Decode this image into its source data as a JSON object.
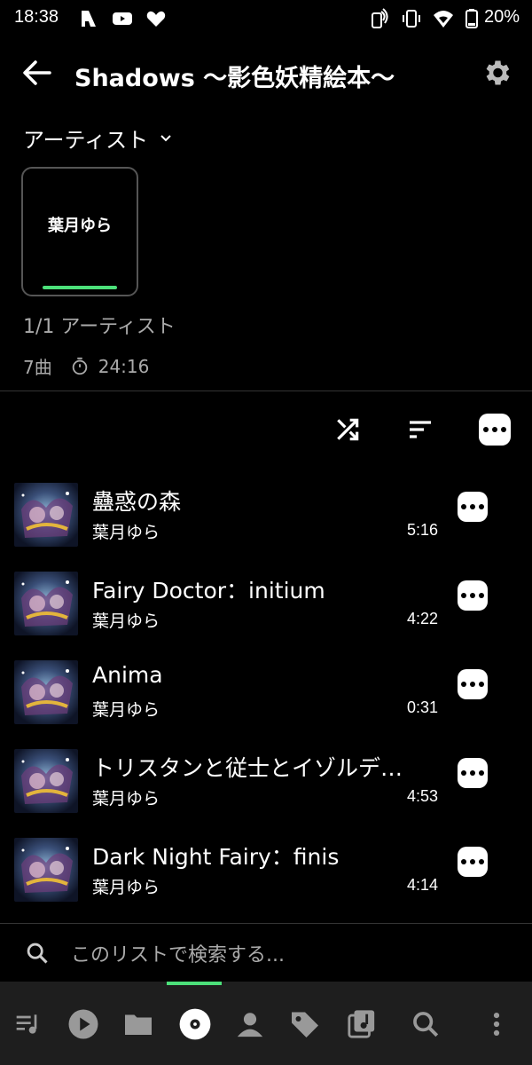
{
  "status_bar": {
    "time": "18:38",
    "battery": "20%",
    "icons": [
      "app-icon",
      "youtube-icon",
      "heart-icon",
      "nfc-icon",
      "vibrate-icon",
      "wifi-icon",
      "battery-icon"
    ]
  },
  "header": {
    "title": "Shadows ～影色妖精絵本～"
  },
  "artist_section": {
    "label": "アーティスト",
    "card_name": "葉月ゆら",
    "count": "1/1 アーティスト",
    "track_count": "7曲",
    "total_time": "24:16"
  },
  "toolbar": {
    "icons": [
      "shuffle-icon",
      "sort-icon",
      "more-icon"
    ]
  },
  "tracks": [
    {
      "title": "蠱惑の森",
      "artist": "葉月ゆら",
      "duration": "5:16"
    },
    {
      "title": "Fairy Doctor：initium",
      "artist": "葉月ゆら",
      "duration": "4:22"
    },
    {
      "title": "Anima",
      "artist": "葉月ゆら",
      "duration": "0:31"
    },
    {
      "title": "トリスタンと従士とイゾルデ…",
      "artist": "葉月ゆら",
      "duration": "4:53"
    },
    {
      "title": "Dark Night Fairy：finis",
      "artist": "葉月ゆら",
      "duration": "4:14"
    }
  ],
  "search": {
    "placeholder": "このリストで検索する..."
  },
  "bottom_nav": {
    "items": [
      "queue-icon",
      "play-icon",
      "folder-icon",
      "album-icon",
      "artist-icon",
      "tag-icon",
      "playlist-icon",
      "search-icon",
      "menu-icon"
    ],
    "active": "album-icon"
  },
  "colors": {
    "accent": "#4ce07a",
    "background": "#000000",
    "nav_background": "#1e1e1e",
    "secondary_text": "#aaaaaa"
  }
}
